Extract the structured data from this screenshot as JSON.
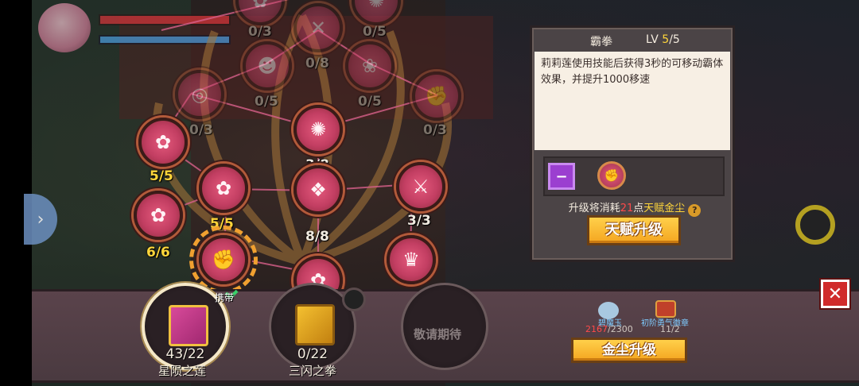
{
  "skill_tree": {
    "nodes": [
      {
        "id": "n1",
        "icon": "lotus-icon",
        "count": "0/3"
      },
      {
        "id": "n2",
        "icon": "bee-icon",
        "count": "0/5"
      },
      {
        "id": "n3",
        "icon": "cross-blade-icon",
        "count": "0/8"
      },
      {
        "id": "n4",
        "icon": "mask-icon",
        "count": "0/5"
      },
      {
        "id": "n5",
        "icon": "flower-icon",
        "count": "0/5"
      },
      {
        "id": "n6",
        "icon": "swirl-icon",
        "count": "0/3"
      },
      {
        "id": "n7",
        "icon": "fist-icon",
        "count": "0/3"
      },
      {
        "id": "n8",
        "icon": "lotus-icon",
        "count": "5/5"
      },
      {
        "id": "n9",
        "icon": "bee-icon",
        "count": "3/8"
      },
      {
        "id": "n10",
        "icon": "lotus-icon",
        "count": "5/5"
      },
      {
        "id": "n11",
        "icon": "crossed-swords-icon",
        "count": "3/3"
      },
      {
        "id": "n12",
        "icon": "lotus-icon",
        "count": "6/6"
      },
      {
        "id": "n13",
        "icon": "knot-icon",
        "count": "8/8"
      },
      {
        "id": "n14",
        "icon": "fist-icon",
        "count": ""
      },
      {
        "id": "n15",
        "icon": "crown-icon",
        "count": ""
      },
      {
        "id": "n16",
        "icon": "lotus-icon",
        "count": ""
      }
    ]
  },
  "detail_panel": {
    "skill_name": "霸拳",
    "lv_prefix": "LV ",
    "lv_current": "5",
    "lv_max": "/5",
    "description": "莉莉莲使用技能后获得3秒的可移动霸体效果，并提升1000移速",
    "cost_prefix": "升级将消耗",
    "cost_amount": "21",
    "cost_mid": "点",
    "cost_item": "天赋金尘",
    "help": "?",
    "upgrade_label": "天赋升级",
    "slot_minus": "−"
  },
  "books": [
    {
      "name": "星陨之莲",
      "count": "43/22",
      "carry": "携带"
    },
    {
      "name": "三闪之拳",
      "count": "0/22"
    },
    {
      "name": "",
      "count": "",
      "locked": "敬请期待"
    }
  ],
  "currency": {
    "c1_label": "碧魔玉",
    "c1_have": "2167",
    "c1_need": "/2300",
    "c2_label": "初阶勇气徽章",
    "c2_value": "11/2",
    "gold_upgrade_label": "金尘升级"
  },
  "colors": {
    "accent": "#f4a520",
    "node": "#c23e62",
    "panel": "#4b4446",
    "cost_red": "#ff4a4a",
    "gold_text": "#ffd63a"
  },
  "icons": {
    "close": "close-icon",
    "side_tab": "chevron-right-icon"
  }
}
